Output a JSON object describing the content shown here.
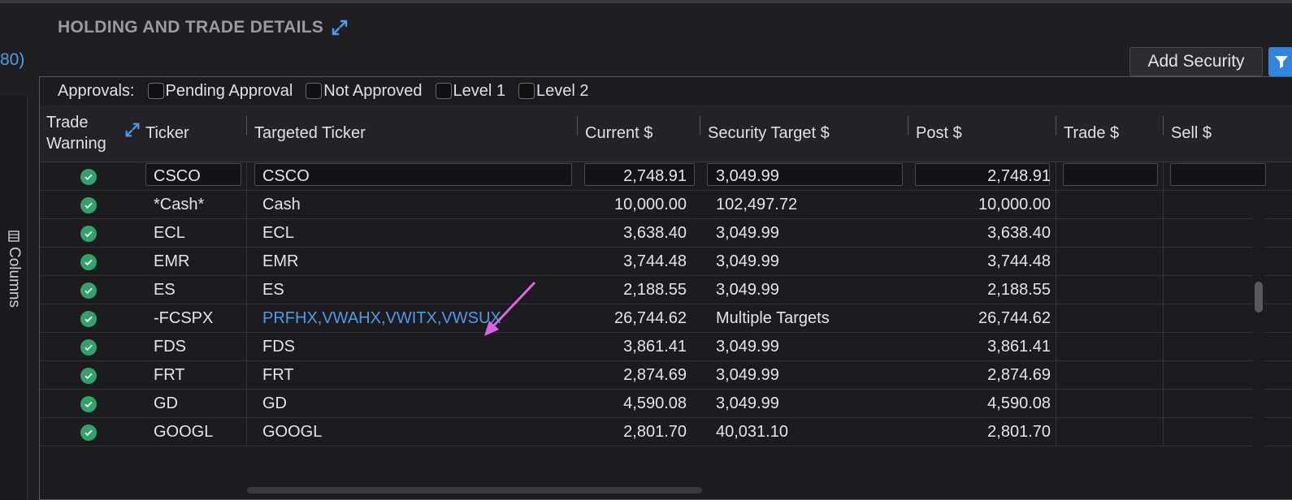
{
  "panel": {
    "title": "HOLDING AND TRADE DETAILS",
    "left_link": "80)"
  },
  "sidebar": {
    "columns_label": "Columns"
  },
  "toolbar": {
    "add_security_label": "Add Security"
  },
  "approvals": {
    "label": "Approvals:",
    "options": [
      "Pending Approval",
      "Not Approved",
      "Level 1",
      "Level 2"
    ]
  },
  "columns": {
    "trade_warning_line1": "Trade",
    "trade_warning_line2": "Warning",
    "ticker": "Ticker",
    "targeted_ticker": "Targeted Ticker",
    "current": "Current $",
    "security_target": "Security Target $",
    "post": "Post $",
    "trade": "Trade $",
    "sell": "Sell $"
  },
  "rows": [
    {
      "ticker": "CSCO",
      "targeted": "CSCO",
      "current": "2,748.91",
      "target": "3,049.99",
      "post": "2,748.91"
    },
    {
      "ticker": "*Cash*",
      "targeted": "Cash",
      "current": "10,000.00",
      "target": "102,497.72",
      "post": "10,000.00"
    },
    {
      "ticker": "ECL",
      "targeted": "ECL",
      "current": "3,638.40",
      "target": "3,049.99",
      "post": "3,638.40"
    },
    {
      "ticker": "EMR",
      "targeted": "EMR",
      "current": "3,744.48",
      "target": "3,049.99",
      "post": "3,744.48"
    },
    {
      "ticker": "ES",
      "targeted": "ES",
      "current": "2,188.55",
      "target": "3,049.99",
      "post": "2,188.55"
    },
    {
      "ticker": "-FCSPX",
      "targeted": "PRFHX,VWAHX,VWITX,VWSUX",
      "current": "26,744.62",
      "target": "Multiple Targets",
      "post": "26,744.62"
    },
    {
      "ticker": "FDS",
      "targeted": "FDS",
      "current": "3,861.41",
      "target": "3,049.99",
      "post": "3,861.41"
    },
    {
      "ticker": "FRT",
      "targeted": "FRT",
      "current": "2,874.69",
      "target": "3,049.99",
      "post": "2,874.69"
    },
    {
      "ticker": "GD",
      "targeted": "GD",
      "current": "4,590.08",
      "target": "3,049.99",
      "post": "4,590.08"
    },
    {
      "ticker": "GOOGL",
      "targeted": "GOOGL",
      "current": "2,801.70",
      "target": "40,031.10",
      "post": "2,801.70"
    }
  ],
  "colors": {
    "accent": "#4a9ee8",
    "success": "#2fa36b",
    "annotation_arrow": "#e060e8"
  }
}
